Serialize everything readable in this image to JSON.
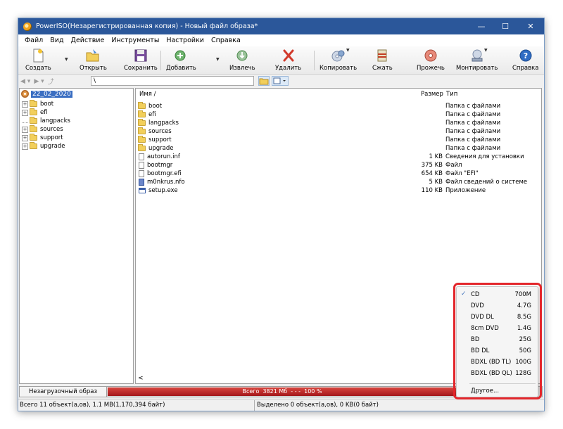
{
  "window": {
    "title": "PowerISO(Незарегистрированная копия) - Новый файл образа*",
    "controls": {
      "minimize": "—",
      "maximize": "☐",
      "close": "✕"
    }
  },
  "menu": [
    "Файл",
    "Вид",
    "Действие",
    "Инструменты",
    "Настройки",
    "Справка"
  ],
  "toolbar": {
    "create": "Создать",
    "open": "Открыть",
    "save": "Сохранить",
    "add": "Добавить",
    "extract": "Извлечь",
    "delete": "Удалить",
    "copy": "Копировать",
    "compress": "Сжать",
    "burn": "Прожечь",
    "mount": "Монтировать",
    "help": "Справка"
  },
  "address": {
    "path": "\\"
  },
  "tree": {
    "root": "22_02_2020",
    "items": [
      {
        "label": "boot",
        "expandable": true
      },
      {
        "label": "efi",
        "expandable": true
      },
      {
        "label": "langpacks",
        "expandable": false
      },
      {
        "label": "sources",
        "expandable": true
      },
      {
        "label": "support",
        "expandable": true
      },
      {
        "label": "upgrade",
        "expandable": true
      }
    ]
  },
  "files": {
    "columns": {
      "name": "Имя  /",
      "size": "Размер",
      "type": "Тип"
    },
    "rows": [
      {
        "name": "boot",
        "size": "",
        "type": "Папка с файлами",
        "icon": "folder-icon"
      },
      {
        "name": "efi",
        "size": "",
        "type": "Папка с файлами",
        "icon": "folder-icon"
      },
      {
        "name": "langpacks",
        "size": "",
        "type": "Папка с файлами",
        "icon": "folder-icon"
      },
      {
        "name": "sources",
        "size": "",
        "type": "Папка с файлами",
        "icon": "folder-icon"
      },
      {
        "name": "support",
        "size": "",
        "type": "Папка с файлами",
        "icon": "folder-icon"
      },
      {
        "name": "upgrade",
        "size": "",
        "type": "Папка с файлами",
        "icon": "folder-icon"
      },
      {
        "name": "autorun.inf",
        "size": "1 KB",
        "type": "Сведения для установки",
        "icon": "settings-file-icon"
      },
      {
        "name": "bootmgr",
        "size": "375 KB",
        "type": "Файл",
        "icon": "file-icon"
      },
      {
        "name": "bootmgr.efi",
        "size": "654 KB",
        "type": "Файл \"EFI\"",
        "icon": "file-icon"
      },
      {
        "name": "m0nkrus.nfo",
        "size": "5 KB",
        "type": "Файл сведений о системе",
        "icon": "info-file-icon"
      },
      {
        "name": "setup.exe",
        "size": "110 KB",
        "type": "Приложение",
        "icon": "exe-icon"
      }
    ]
  },
  "capacity": {
    "media_type": "Незагрузочный образ",
    "total": "Всего  3821 Мб  - - -  100 %",
    "used_fraction": 1.0
  },
  "status": {
    "left": "Всего 11 объект(а,ов), 1.1 MB(1,170,394 байт)",
    "right": "Выделено 0 объект(а,ов), 0 KB(0 байт)"
  },
  "capacity_menu": {
    "selected": "CD",
    "options": [
      {
        "name": "CD",
        "cap": "700M"
      },
      {
        "name": "DVD",
        "cap": "4.7G"
      },
      {
        "name": "DVD DL",
        "cap": "8.5G"
      },
      {
        "name": "8cm DVD",
        "cap": "1.4G"
      },
      {
        "name": "BD",
        "cap": "25G"
      },
      {
        "name": "BD DL",
        "cap": "50G"
      },
      {
        "name": "BDXL (BD TL)",
        "cap": "100G"
      },
      {
        "name": "BDXL (BD QL)",
        "cap": "128G"
      }
    ],
    "other": "Другое...",
    "check_mark": "✓"
  },
  "colors": {
    "titlebar": "#2b579a",
    "capacity_fill": "#c0282a",
    "highlight": "#e3262b",
    "selection": "#3a6ec2"
  }
}
